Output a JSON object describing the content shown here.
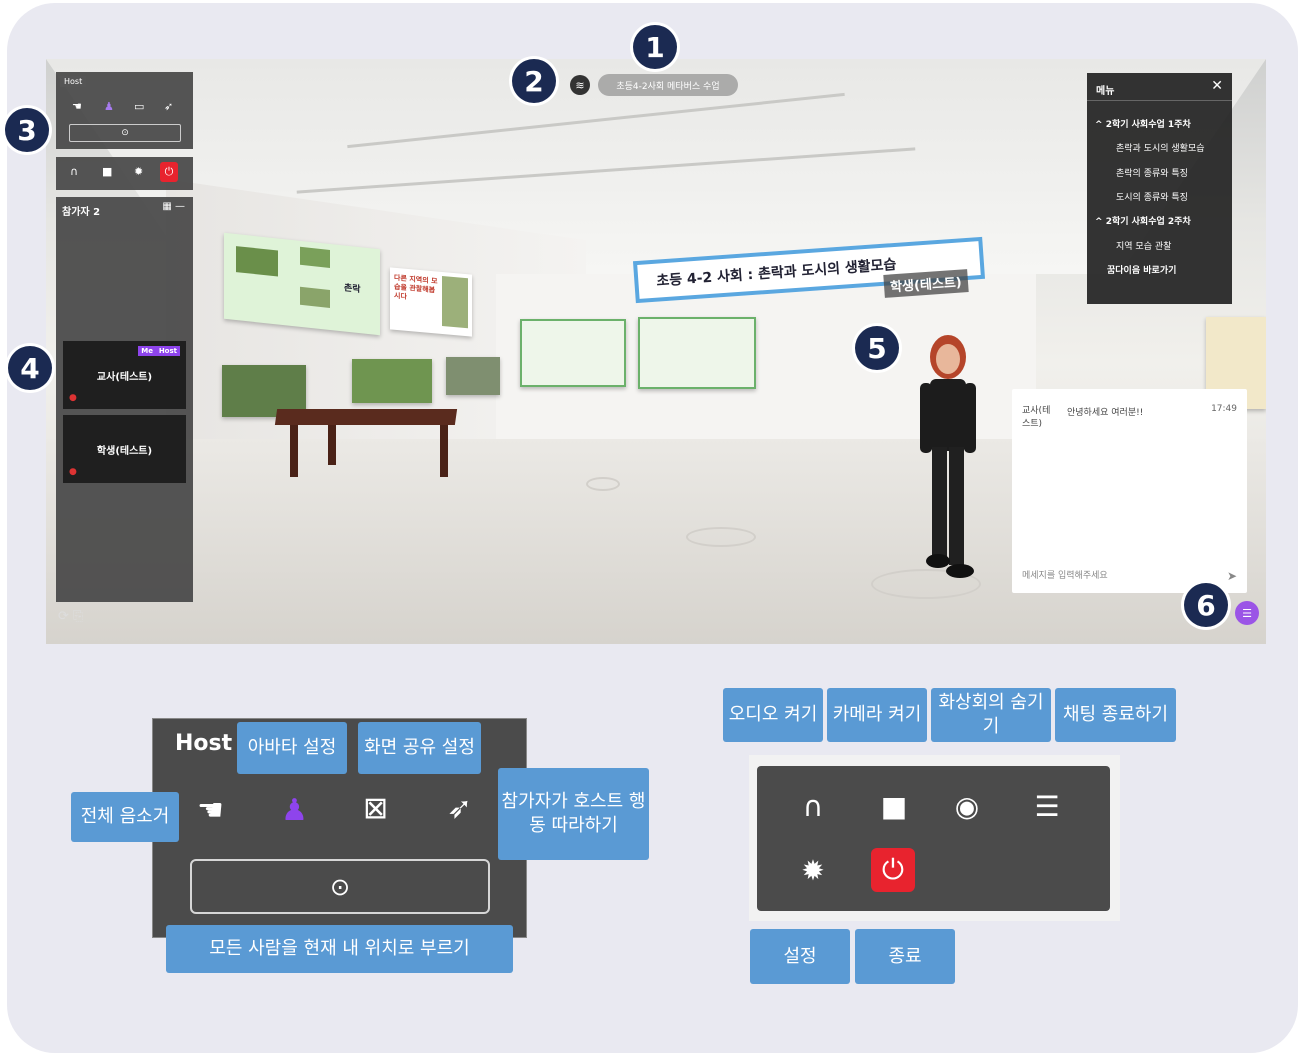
{
  "scene": {
    "title_pill": "초등4-2사회 메타버스 수업",
    "banner": "초등 4-2 사회 : 촌락과 도시의 생활모습",
    "avatar_name_tag": "학생(테스트)",
    "art_label": "촌락",
    "art_text": "다른 지역의 모습을 관찰해봅시다"
  },
  "markers": [
    "1",
    "2",
    "3",
    "4",
    "5",
    "6"
  ],
  "mini_host": {
    "tag": "Host"
  },
  "participants": {
    "header": "참가자 2",
    "cards": [
      {
        "name": "교사(테스트)",
        "badges": [
          "Me",
          "Host"
        ]
      },
      {
        "name": "학생(테스트)",
        "badges": []
      }
    ]
  },
  "menu": {
    "title": "메뉴",
    "close": "✕",
    "items": [
      {
        "label": "2학기 사회수업 1주차",
        "bold": true,
        "chevron": "^"
      },
      {
        "label": "촌락과 도시의 생활모습",
        "bold": false
      },
      {
        "label": "촌락의 종류와 특징",
        "bold": false
      },
      {
        "label": "도시의 종류와 특징",
        "bold": false
      },
      {
        "label": "2학기 사회수업 2주차",
        "bold": true,
        "chevron": "^"
      },
      {
        "label": "지역 모습 관찰",
        "bold": false
      },
      {
        "label": "꿈다이음 바로가기",
        "bold": true
      }
    ]
  },
  "chat": {
    "sender": "교사(테스트)",
    "message": "안녕하세요 여러분!!",
    "time": "17:49",
    "placeholder": "메세지를 입력해주세요"
  },
  "host_panel": {
    "title": "Host",
    "labels": {
      "mute_all": "전체 음소거",
      "avatar_settings": "아바타 설정",
      "screen_share": "화면 공유 설정",
      "follow_host": "참가자가 호스트 행동 따라하기",
      "call_all": "모든 사람을 현재 내 위치로 부르기"
    },
    "icons": [
      "hand-mute-icon",
      "avatar-person-icon",
      "screen-share-off-icon",
      "cursor-follow-icon",
      "focus-target-icon"
    ],
    "accent": "#8e44ec"
  },
  "controls_panel": {
    "labels": {
      "audio_on": "오디오 켜기",
      "camera_on": "카메라 켜기",
      "hide_video": "화상회의 숨기기",
      "end_chat": "채팅 종료하기",
      "settings": "설정",
      "exit": "종료"
    },
    "icons": [
      "headset-icon",
      "camera-icon",
      "eye-icon",
      "chat-icon",
      "gear-icon",
      "power-icon"
    ],
    "power_color": "#e8232e"
  },
  "label_color": "#5a9ad4",
  "marker_color": "#1b2a52"
}
